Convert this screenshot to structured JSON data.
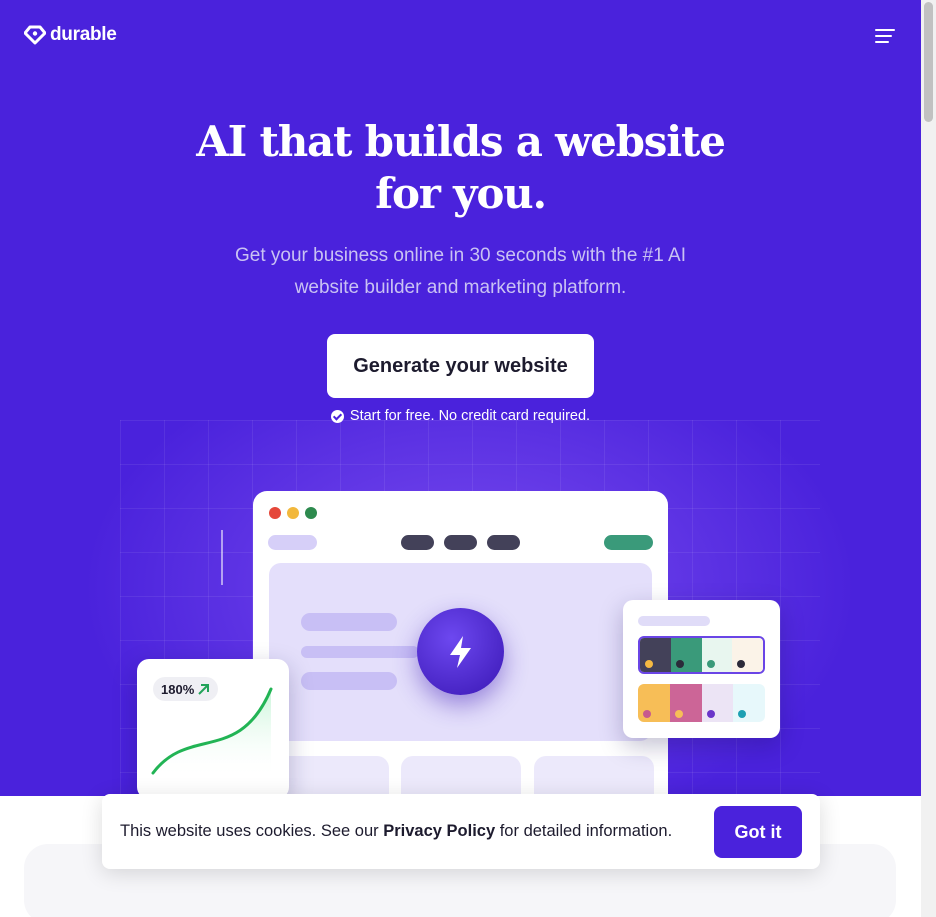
{
  "brand": {
    "name": "durable",
    "primary": "#4a22dc"
  },
  "nav": {
    "menu_icon": "hamburger-menu-icon"
  },
  "hero": {
    "headline_line1": "AI that builds a website",
    "headline_line2": "for you.",
    "subtitle_line1": "Get your business online in 30 seconds with the #1 AI",
    "subtitle_line2": "website builder and marketing platform.",
    "cta_label": "Generate your website",
    "note": "Start for free. No credit card required."
  },
  "illustration": {
    "window_dots": [
      "#e5473a",
      "#f2b83c",
      "#2d8a4e"
    ],
    "nav_pill_color": "#434159",
    "accent_pill_color": "#3a9a7a",
    "center_icon": "lightning-bolt-icon",
    "stat": {
      "label": "180%",
      "icon": "arrow-up-right-icon",
      "trend_color": "#22c55e"
    },
    "palette": {
      "row1": [
        {
          "bg": "#434159",
          "dot": "#f5b942"
        },
        {
          "bg": "#3a9a7a",
          "dot": "#2b2a3a"
        },
        {
          "bg": "#e8f6ef",
          "dot": "#3a9a7a"
        },
        {
          "bg": "#fbf3e8",
          "dot": "#2b2a3a"
        }
      ],
      "row2": [
        {
          "bg": "#f7be57",
          "dot": "#c75a8e"
        },
        {
          "bg": "#cc6597",
          "dot": "#f7be57"
        },
        {
          "bg": "#ece4f5",
          "dot": "#6b35c9"
        },
        {
          "bg": "#e7f8fb",
          "dot": "#1da0b3"
        }
      ]
    }
  },
  "cookie": {
    "text_before": "This website uses cookies. See our ",
    "link": "Privacy Policy",
    "text_after": " for detailed information.",
    "button": "Got it"
  }
}
